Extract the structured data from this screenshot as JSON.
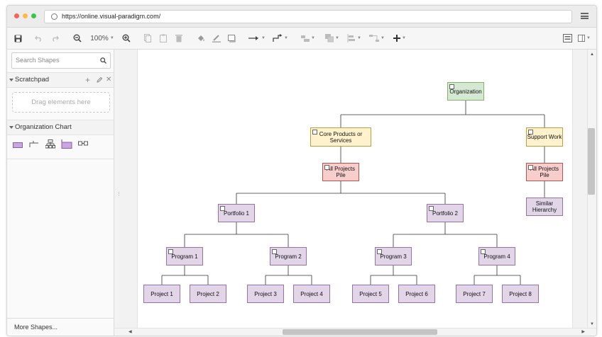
{
  "browser": {
    "url": "https://online.visual-paradigm.com/",
    "dots": [
      "#fc605c",
      "#fdbc40",
      "#34c84a"
    ]
  },
  "toolbar": {
    "zoom": "100%"
  },
  "sidebar": {
    "search_placeholder": "Search Shapes",
    "scratchpad_title": "Scratchpad",
    "drag_hint": "Drag elements here",
    "org_chart_title": "Organization Chart",
    "more_shapes": "More Shapes..."
  },
  "diagram": {
    "root": "Organization",
    "core": "Core Products or Services",
    "support": "Support Work",
    "pile_left": "All Projects Pile",
    "pile_right": "All Projects Pile",
    "similar": "Similar Hierarchy",
    "portfolios": [
      "Portfolio 1",
      "Portfolio 2"
    ],
    "programs": [
      "Program 1",
      "Program 2",
      "Program 3",
      "Program 4"
    ],
    "projects": [
      "Project 1",
      "Project 2",
      "Project 3",
      "Project 4",
      "Project 5",
      "Project 6",
      "Project 7",
      "Project 8"
    ]
  },
  "colors": {
    "root": "#d5e8d4",
    "level1": "#fff2cc",
    "pile": "#f8cecc",
    "item": "#e1d5e7"
  }
}
